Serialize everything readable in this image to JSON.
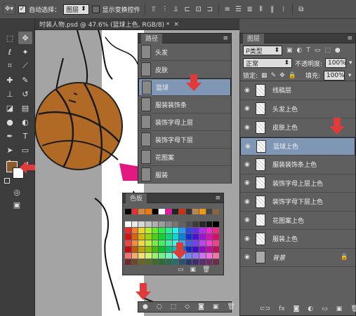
{
  "options_bar": {
    "auto_select_label": "自动选择：",
    "auto_select_value": "图层",
    "show_transform_label": "显示变换控件"
  },
  "document": {
    "tab_title": "时装人物.psd @ 47.6% (篮球上色, RGB/8) *",
    "close": "×"
  },
  "paths_panel": {
    "title": "路径",
    "items": [
      {
        "label": "头发"
      },
      {
        "label": "皮肤"
      },
      {
        "label": "篮球"
      },
      {
        "label": "服装装饰条"
      },
      {
        "label": "装饰字母上层"
      },
      {
        "label": "装饰字母下层"
      },
      {
        "label": "花图案"
      },
      {
        "label": "服装"
      }
    ],
    "selected_index": 2
  },
  "swatches_panel": {
    "title": "色板"
  },
  "layers_panel": {
    "title": "图层",
    "filter_label": "类型",
    "blend_mode": "正常",
    "opacity_label": "不透明度:",
    "opacity_value": "100%",
    "lock_label": "锁定:",
    "fill_label": "填充:",
    "fill_value": "100%",
    "items": [
      {
        "label": "线稿层"
      },
      {
        "label": "头发上色"
      },
      {
        "label": "皮肤上色"
      },
      {
        "label": "篮球上色"
      },
      {
        "label": "服装装饰条上色"
      },
      {
        "label": "装饰字母上层上色"
      },
      {
        "label": "装饰字母下层上色"
      },
      {
        "label": "花图案上色"
      },
      {
        "label": "服装上色"
      },
      {
        "label": "背景"
      }
    ],
    "selected_index": 3
  },
  "colors": {
    "foreground": "#8b5a2b",
    "background": "#ffffff",
    "accent_red": "#e03a3a",
    "selection": "#8096b5"
  }
}
